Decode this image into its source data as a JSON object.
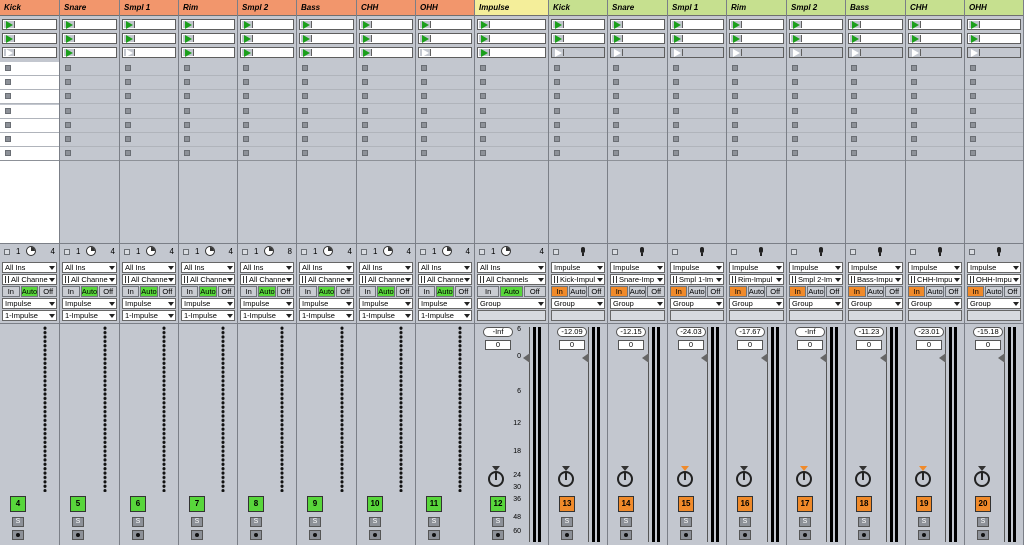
{
  "tracks": [
    {
      "name": "Kick",
      "type": "midi",
      "input_type": "All Ins",
      "input_channel": "All Channe",
      "monitor": [
        "In",
        "Auto",
        "Off"
      ],
      "output_type": "Impulse",
      "output_channel": "1-Impulse",
      "number": "4",
      "n1": "1",
      "n2": "4"
    },
    {
      "name": "Snare",
      "type": "midi",
      "input_type": "All Ins",
      "input_channel": "All Channe",
      "monitor": [
        "In",
        "Auto",
        "Off"
      ],
      "output_type": "Impulse",
      "output_channel": "1-Impulse",
      "number": "5",
      "n1": "1",
      "n2": "4"
    },
    {
      "name": "Smpl 1",
      "type": "midi",
      "input_type": "All Ins",
      "input_channel": "All Channe",
      "monitor": [
        "In",
        "Auto",
        "Off"
      ],
      "output_type": "Impulse",
      "output_channel": "1-Impulse",
      "number": "6",
      "n1": "1",
      "n2": "4"
    },
    {
      "name": "Rim",
      "type": "midi",
      "input_type": "All Ins",
      "input_channel": "All Channe",
      "monitor": [
        "In",
        "Auto",
        "Off"
      ],
      "output_type": "Impulse",
      "output_channel": "1-Impulse",
      "number": "7",
      "n1": "1",
      "n2": "4"
    },
    {
      "name": "Smpl 2",
      "type": "midi",
      "input_type": "All Ins",
      "input_channel": "All Channe",
      "monitor": [
        "In",
        "Auto",
        "Off"
      ],
      "output_type": "Impulse",
      "output_channel": "1-Impulse",
      "number": "8",
      "n1": "1",
      "n2": "8"
    },
    {
      "name": "Bass",
      "type": "midi",
      "input_type": "All Ins",
      "input_channel": "All Channe",
      "monitor": [
        "In",
        "Auto",
        "Off"
      ],
      "output_type": "Impulse",
      "output_channel": "1-Impulse",
      "number": "9",
      "n1": "1",
      "n2": "4"
    },
    {
      "name": "CHH",
      "type": "midi",
      "input_type": "All Ins",
      "input_channel": "All Channe",
      "monitor": [
        "In",
        "Auto",
        "Off"
      ],
      "output_type": "Impulse",
      "output_channel": "1-Impulse",
      "number": "10",
      "n1": "1",
      "n2": "4"
    },
    {
      "name": "OHH",
      "type": "midi",
      "input_type": "All Ins",
      "input_channel": "All Channe",
      "monitor": [
        "In",
        "Auto",
        "Off"
      ],
      "output_type": "Impulse",
      "output_channel": "1-Impulse",
      "number": "11",
      "n1": "1",
      "n2": "4"
    },
    {
      "name": "Impulse",
      "type": "group",
      "input_type": "All Ins",
      "input_channel": "All Channels",
      "monitor": [
        "In",
        "Auto",
        "Off"
      ],
      "output_type": "Group",
      "output_channel": "",
      "volume": "-Inf",
      "pan_value": "0",
      "number": "12",
      "n1": "1",
      "n2": "4"
    },
    {
      "name": "Kick",
      "type": "audio",
      "input_type": "Impulse",
      "input_channel": "Kick-Impul",
      "monitor": [
        "In",
        "Auto",
        "Off"
      ],
      "output_type": "Group",
      "output_channel": "",
      "volume": "-12.09",
      "pan_value": "0",
      "number": "13"
    },
    {
      "name": "Snare",
      "type": "audio",
      "input_type": "Impulse",
      "input_channel": "Snare-Imp",
      "monitor": [
        "In",
        "Auto",
        "Off"
      ],
      "output_type": "Group",
      "output_channel": "",
      "volume": "-12.15",
      "pan_value": "0",
      "number": "14"
    },
    {
      "name": "Smpl 1",
      "type": "audio",
      "input_type": "Impulse",
      "input_channel": "Smpl 1-Im",
      "monitor": [
        "In",
        "Auto",
        "Off"
      ],
      "output_type": "Group",
      "output_channel": "",
      "volume": "-24.03",
      "pan_value": "0",
      "number": "15"
    },
    {
      "name": "Rim",
      "type": "audio",
      "input_type": "Impulse",
      "input_channel": "Rim-Impul",
      "monitor": [
        "In",
        "Auto",
        "Off"
      ],
      "output_type": "Group",
      "output_channel": "",
      "volume": "-17.67",
      "pan_value": "0",
      "number": "16"
    },
    {
      "name": "Smpl 2",
      "type": "audio",
      "input_type": "Impulse",
      "input_channel": "Smpl 2-Im",
      "monitor": [
        "In",
        "Auto",
        "Off"
      ],
      "output_type": "Group",
      "output_channel": "",
      "volume": "-Inf",
      "pan_value": "0",
      "number": "17"
    },
    {
      "name": "Bass",
      "type": "audio",
      "input_type": "Impulse",
      "input_channel": "Bass-Impu",
      "monitor": [
        "In",
        "Auto",
        "Off"
      ],
      "output_type": "Group",
      "output_channel": "",
      "volume": "-11.23",
      "pan_value": "0",
      "number": "18"
    },
    {
      "name": "CHH",
      "type": "audio",
      "input_type": "Impulse",
      "input_channel": "CHH-Impu",
      "monitor": [
        "In",
        "Auto",
        "Off"
      ],
      "output_type": "Group",
      "output_channel": "",
      "volume": "-23.01",
      "pan_value": "0",
      "number": "19"
    },
    {
      "name": "OHH",
      "type": "audio",
      "input_type": "Impulse",
      "input_channel": "OHH-Impu",
      "monitor": [
        "In",
        "Auto",
        "Off"
      ],
      "output_type": "Group",
      "output_channel": "",
      "volume": "-15.18",
      "pan_value": "0",
      "number": "20"
    }
  ],
  "db_scale": [
    "6",
    "0",
    "6",
    "12",
    "18",
    "24",
    "30",
    "36",
    "48",
    "60"
  ],
  "solo_label": "S",
  "colors": {
    "midi_header": "#f2966c",
    "group_header": "#f4ee9a",
    "audio_header": "#c6e08f",
    "monitor_on_midi": "#58d63b",
    "monitor_on_audio": "#f08a2a",
    "track_number_midi": "#58d63b",
    "track_number_audio": "#f08a2a"
  }
}
